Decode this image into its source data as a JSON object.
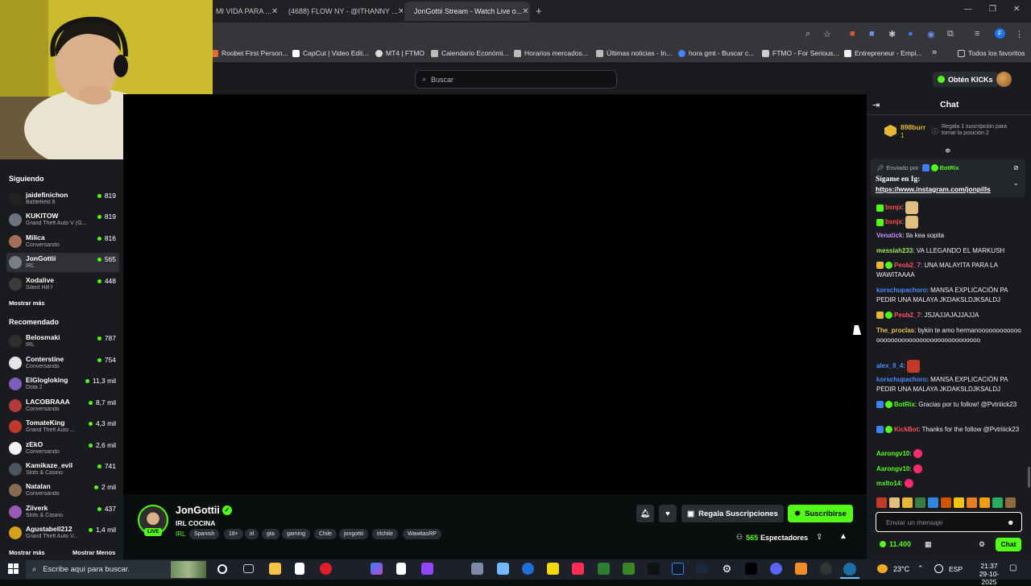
{
  "browser": {
    "tabs": [
      {
        "label": "MI VIDA PARA ...",
        "active": false
      },
      {
        "label": "(4688) FLOW NY - @ITHANNY ...",
        "active": false
      },
      {
        "label": "JonGottii Stream - Watch Live o...",
        "active": true
      }
    ],
    "new_tab": "+",
    "bookmarks": [
      "Roobet First Person...",
      "CapCut | Video Edit...",
      "MT4 | FTMO",
      "Calendario Económi...",
      "Horarios mercados...",
      "Últimas noticias - In...",
      "hora gmt - Buscar c...",
      "FTMO - For Serious...",
      "Entrepreneur - Empi..."
    ],
    "bookmarks_more": "»",
    "all_favorites": "Todos los favoritos"
  },
  "header": {
    "search_placeholder": "Buscar",
    "get_kicks": "Obtén KICKs"
  },
  "sidebar": {
    "following_title": "Siguiendo",
    "following": [
      {
        "name": "jaidefinichon",
        "category": "Battlefield 6",
        "viewers": "819"
      },
      {
        "name": "KUKITOW",
        "category": "Grand Theft Auto V (G...",
        "viewers": "819"
      },
      {
        "name": "Milica",
        "category": "Conversando",
        "viewers": "816"
      },
      {
        "name": "JonGottii",
        "category": "IRL",
        "viewers": "565"
      },
      {
        "name": "Xodalive",
        "category": "Silent Hill f",
        "viewers": "448"
      }
    ],
    "show_more_1": "Mostrar más",
    "recommended_title": "Recomendado",
    "recommended": [
      {
        "name": "Belosmaki",
        "category": "IRL",
        "viewers": "787"
      },
      {
        "name": "Conterstine",
        "category": "Conversando",
        "viewers": "754"
      },
      {
        "name": "ElGlogloking",
        "category": "Dota 2",
        "viewers": "11,3 mil"
      },
      {
        "name": "LACOBRAAA",
        "category": "Conversando",
        "viewers": "8,7 mil"
      },
      {
        "name": "TomateKing",
        "category": "Grand Theft Auto ...",
        "viewers": "4,3 mil"
      },
      {
        "name": "zEkO",
        "category": "Conversando",
        "viewers": "2,6 mil"
      },
      {
        "name": "Kamikaze_evil",
        "category": "Slots & Casino",
        "viewers": "741"
      },
      {
        "name": "Natalan",
        "category": "Conversando",
        "viewers": "2 mil"
      },
      {
        "name": "Ziiverk",
        "category": "Slots & Casino",
        "viewers": "437"
      },
      {
        "name": "Agustabell212",
        "category": "Grand Theft Auto V...",
        "viewers": "1,4 mil"
      }
    ],
    "show_more_2": "Mostrar más",
    "show_less": "Mostrar Menos"
  },
  "stream": {
    "channel": "JonGottii",
    "title": "IRL COCINA",
    "live": "LIVE",
    "category": "IRL",
    "tags": [
      "Spanish",
      "18+",
      "irl",
      "gta",
      "gaming",
      "Chile",
      "jongottii",
      "irlchile",
      "WawitasRP"
    ],
    "gift_subs": "Regala Suscripciones",
    "subscribe": "Suscribirse",
    "viewers": "565",
    "viewers_label": "Espectadores"
  },
  "chat": {
    "title": "Chat",
    "top_gifter": {
      "name": "898burr",
      "count": "1"
    },
    "gift_prompt": "Regala 1 suscripción para tomar la posición 2",
    "pinned": {
      "sent_by": "Enviado por",
      "sender": "BotRix",
      "line1": "Sígame en Ig:",
      "line2": "https://www.instagram.com/jonpills"
    },
    "messages": [
      {
        "user": "bsnjx",
        "text": "",
        "color": "#ff4f4f"
      },
      {
        "user": "bsnjx",
        "text": "",
        "color": "#ff4f4f"
      },
      {
        "user": "Venatick",
        "text": "tla kea sopita",
        "color": "#c78bff"
      },
      {
        "user": "messiah233",
        "text": "VA LLEGANDO EL MARKUSH",
        "color": "#9ee86a"
      },
      {
        "user": "Peob2_7",
        "text": "UNA MALAYITA PARA LA WAWITAAAA",
        "color": "#ff4f6a"
      },
      {
        "user": "korschupachoro",
        "text": "MANSA EXPLICACIÓN PA PEDIR UNA MALAYA JKDAKSLDJKSALDJ",
        "color": "#4a8cff"
      },
      {
        "user": "Peob2_7",
        "text": "JSJAJJAJAJJAJJA",
        "color": "#ff4f6a"
      },
      {
        "user": "The_proclas",
        "text": "bykin te amo hermanooooooooooooooooooooooooooooooooooooooooo",
        "color": "#f2c14e"
      },
      {
        "user": "alex_9_4",
        "text": "",
        "color": "#4a8cff"
      },
      {
        "user": "korschupachoro",
        "text": "MANSA EXPLICACIÓN PA PEDIR UNA MALAYA JKDAKSLDJKSALDJ",
        "color": "#4a8cff"
      },
      {
        "user": "BotRix",
        "text": "Gracias por tu follow! @Pvtriiick23",
        "color": "#53fc18"
      },
      {
        "user": "KickBot",
        "text": "Thanks for the follow @Pvtriiick23",
        "color": "#ff4f4f"
      },
      {
        "user": "Aarongv10",
        "text": "",
        "color": "#53fc18"
      },
      {
        "user": "Aarongv10",
        "text": "",
        "color": "#53fc18"
      },
      {
        "user": "mxlto14",
        "text": "",
        "color": "#53fc18"
      }
    ],
    "input_placeholder": "Enviar un mensaje",
    "kicks_balance": "11.400",
    "send_button": "Chat"
  },
  "taskbar": {
    "search_placeholder": "Escribe aquí para buscar.",
    "weather": "23°C",
    "language": "ESP",
    "time": "21:37",
    "date": "29-10-2025"
  },
  "colors": {
    "kick_green": "#53fc18",
    "chat_bg": "#191b1f",
    "video_bg": "#000000"
  }
}
